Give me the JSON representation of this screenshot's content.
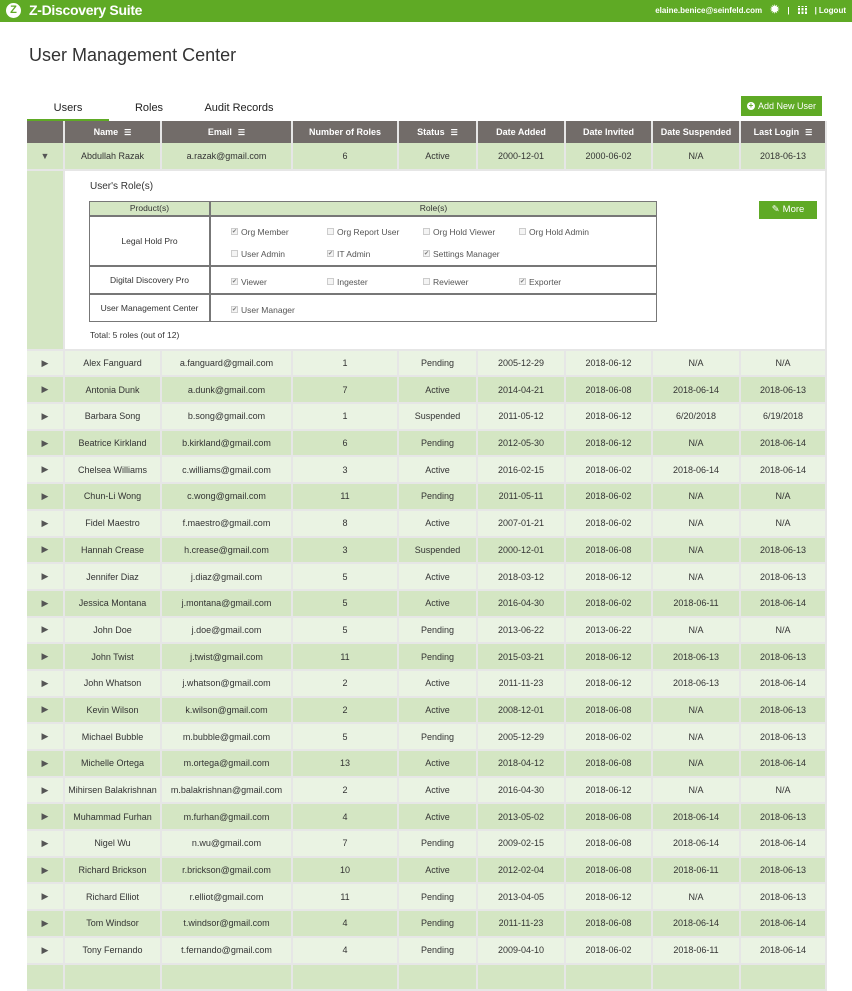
{
  "header": {
    "brand": "Z-Discovery Suite",
    "logo_letter": "Z",
    "user_email": "elaine.benice@seinfeld.com",
    "separator": "|",
    "logout": "Logout"
  },
  "page_title": "User Management Center",
  "tabs": [
    {
      "label": "Users"
    },
    {
      "label": "Roles"
    },
    {
      "label": "Audit Records"
    }
  ],
  "add_user_label": "Add New User",
  "columns": [
    "Name",
    "Email",
    "Number of Roles",
    "Status",
    "Date Added",
    "Date Invited",
    "Date Suspended",
    "Last Login"
  ],
  "sortable": [
    true,
    true,
    false,
    true,
    false,
    false,
    false,
    true
  ],
  "expanded": {
    "title": "User's Role(s)",
    "product_header": "Product(s)",
    "roles_header": "Role(s)",
    "more_label": "More",
    "total": "Total: 5 roles (out of 12)",
    "products": [
      {
        "name": "Legal Hold Pro",
        "roles": [
          {
            "label": "Org Member",
            "checked": true
          },
          {
            "label": "Org Report User",
            "checked": false
          },
          {
            "label": "Org Hold Viewer",
            "checked": false
          },
          {
            "label": "Org Hold Admin",
            "checked": false
          },
          {
            "label": "User Admin",
            "checked": false
          },
          {
            "label": "IT Admin",
            "checked": true
          },
          {
            "label": "Settings Manager",
            "checked": true
          }
        ]
      },
      {
        "name": "Digital Discovery Pro",
        "roles": [
          {
            "label": "Viewer",
            "checked": true
          },
          {
            "label": "Ingester",
            "checked": false
          },
          {
            "label": "Reviewer",
            "checked": false
          },
          {
            "label": "Exporter",
            "checked": true
          }
        ]
      },
      {
        "name": "User Management Center",
        "roles": [
          {
            "label": "User Manager",
            "checked": true
          }
        ]
      }
    ]
  },
  "users": [
    [
      "Abdullah Razak",
      "a.razak@gmail.com",
      "6",
      "Active",
      "2000-12-01",
      "2000-06-02",
      "N/A",
      "2018-06-13"
    ],
    [
      "Alex Fanguard",
      "a.fanguard@gmail.com",
      "1",
      "Pending",
      "2005-12-29",
      "2018-06-12",
      "N/A",
      "N/A"
    ],
    [
      "Antonia Dunk",
      "a.dunk@gmail.com",
      "7",
      "Active",
      "2014-04-21",
      "2018-06-08",
      "2018-06-14",
      "2018-06-13"
    ],
    [
      "Barbara Song",
      "b.song@gmail.com",
      "1",
      "Suspended",
      "2011-05-12",
      "2018-06-12",
      "6/20/2018",
      "6/19/2018"
    ],
    [
      "Beatrice Kirkland",
      "b.kirkland@gmail.com",
      "6",
      "Pending",
      "2012-05-30",
      "2018-06-12",
      "N/A",
      "2018-06-14"
    ],
    [
      "Chelsea Williams",
      "c.williams@gmail.com",
      "3",
      "Active",
      "2016-02-15",
      "2018-06-02",
      "2018-06-14",
      "2018-06-14"
    ],
    [
      "Chun-Li Wong",
      "c.wong@gmail.com",
      "11",
      "Pending",
      "2011-05-11",
      "2018-06-02",
      "N/A",
      "N/A"
    ],
    [
      "Fidel Maestro",
      "f.maestro@gmail.com",
      "8",
      "Active",
      "2007-01-21",
      "2018-06-02",
      "N/A",
      "N/A"
    ],
    [
      "Hannah Crease",
      "h.crease@gmail.com",
      "3",
      "Suspended",
      "2000-12-01",
      "2018-06-08",
      "N/A",
      "2018-06-13"
    ],
    [
      "Jennifer Diaz",
      "j.diaz@gmail.com",
      "5",
      "Active",
      "2018-03-12",
      "2018-06-12",
      "N/A",
      "2018-06-13"
    ],
    [
      "Jessica Montana",
      "j.montana@gmail.com",
      "5",
      "Active",
      "2016-04-30",
      "2018-06-02",
      "2018-06-11",
      "2018-06-14"
    ],
    [
      "John Doe",
      "j.doe@gmail.com",
      "5",
      "Pending",
      "2013-06-22",
      "2013-06-22",
      "N/A",
      "N/A"
    ],
    [
      "John Twist",
      "j.twist@gmail.com",
      "11",
      "Pending",
      "2015-03-21",
      "2018-06-12",
      "2018-06-13",
      "2018-06-13"
    ],
    [
      "John Whatson",
      "j.whatson@gmail.com",
      "2",
      "Active",
      "2011-11-23",
      "2018-06-12",
      "2018-06-13",
      "2018-06-14"
    ],
    [
      "Kevin Wilson",
      "k.wilson@gmail.com",
      "2",
      "Active",
      "2008-12-01",
      "2018-06-08",
      "N/A",
      "2018-06-13"
    ],
    [
      "Michael Bubble",
      "m.bubble@gmail.com",
      "5",
      "Pending",
      "2005-12-29",
      "2018-06-02",
      "N/A",
      "2018-06-13"
    ],
    [
      "Michelle Ortega",
      "m.ortega@gmail.com",
      "13",
      "Active",
      "2018-04-12",
      "2018-06-08",
      "N/A",
      "2018-06-14"
    ],
    [
      "Mihirsen Balakrishnan",
      "m.balakrishnan@gmail.com",
      "2",
      "Active",
      "2016-04-30",
      "2018-06-12",
      "N/A",
      "N/A"
    ],
    [
      "Muhammad Furhan",
      "m.furhan@gmail.com",
      "4",
      "Active",
      "2013-05-02",
      "2018-06-08",
      "2018-06-14",
      "2018-06-13"
    ],
    [
      "Nigel Wu",
      "n.wu@gmail.com",
      "7",
      "Pending",
      "2009-02-15",
      "2018-06-08",
      "2018-06-14",
      "2018-06-14"
    ],
    [
      "Richard Brickson",
      "r.brickson@gmail.com",
      "10",
      "Active",
      "2012-02-04",
      "2018-06-08",
      "2018-06-11",
      "2018-06-13"
    ],
    [
      "Richard Elliot",
      "r.elliot@gmail.com",
      "11",
      "Pending",
      "2013-04-05",
      "2018-06-12",
      "N/A",
      "2018-06-13"
    ],
    [
      "Tom Windsor",
      "t.windsor@gmail.com",
      "4",
      "Pending",
      "2011-11-23",
      "2018-06-08",
      "2018-06-14",
      "2018-06-14"
    ],
    [
      "Tony Fernando",
      "t.fernando@gmail.com",
      "4",
      "Pending",
      "2009-04-10",
      "2018-06-02",
      "2018-06-11",
      "2018-06-14"
    ]
  ]
}
